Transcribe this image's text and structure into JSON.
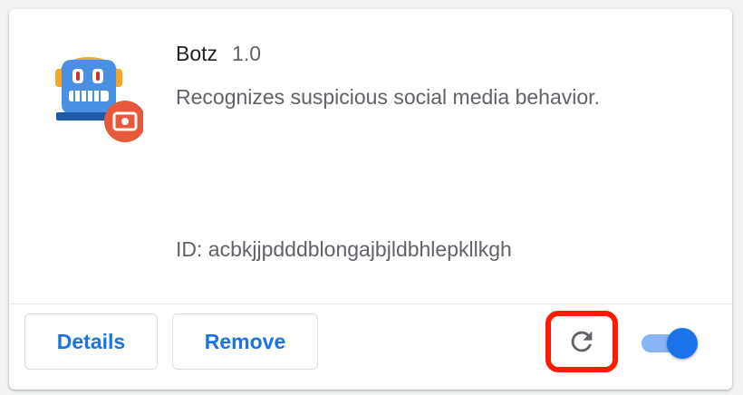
{
  "extension": {
    "name": "Botz",
    "version": "1.0",
    "description": "Recognizes suspicious social media behavior.",
    "id_text": "ID: acbkjjpdddblongajbjldbhlepkllkgh",
    "enabled": true,
    "icon": "robot-icon"
  },
  "actions": {
    "details_label": "Details",
    "remove_label": "Remove",
    "reload_icon": "reload-icon",
    "toggle_icon": "toggle-switch"
  },
  "colors": {
    "accent": "#1a73e8",
    "toggle_track": "#8ab4f8",
    "highlight": "#ff1a00",
    "text_primary": "#202124",
    "text_secondary": "#5f6368"
  }
}
